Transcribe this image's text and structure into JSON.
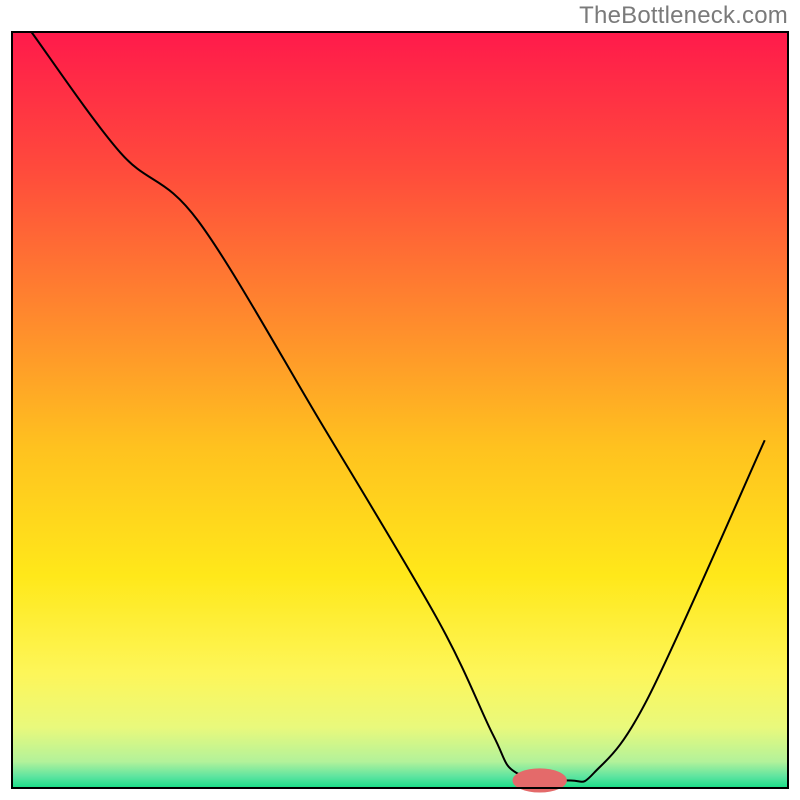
{
  "watermark": "TheBottleneck.com",
  "chart_data": {
    "type": "line",
    "title": "",
    "xlabel": "",
    "ylabel": "",
    "xlim": [
      0,
      100
    ],
    "ylim": [
      0,
      100
    ],
    "grid": false,
    "legend": false,
    "background_gradient_stops": [
      {
        "offset": 0,
        "color": "#ff1a4b"
      },
      {
        "offset": 0.18,
        "color": "#ff4a3c"
      },
      {
        "offset": 0.38,
        "color": "#ff8a2d"
      },
      {
        "offset": 0.55,
        "color": "#ffc21f"
      },
      {
        "offset": 0.72,
        "color": "#ffe81a"
      },
      {
        "offset": 0.85,
        "color": "#fdf65a"
      },
      {
        "offset": 0.92,
        "color": "#e9f97c"
      },
      {
        "offset": 0.965,
        "color": "#b3f29a"
      },
      {
        "offset": 0.985,
        "color": "#5de4a0"
      },
      {
        "offset": 1.0,
        "color": "#18dd87"
      }
    ],
    "series": [
      {
        "name": "bottleneck-curve",
        "color": "#000000",
        "x": [
          2.5,
          14,
          24,
          40,
          55,
          62,
          65,
          72,
          75,
          82,
          97
        ],
        "y": [
          100,
          84,
          75,
          48,
          22,
          7,
          2,
          1,
          2,
          12,
          46
        ]
      }
    ],
    "marker": {
      "name": "highlight-marker",
      "color": "#e46a6a",
      "x": 68,
      "y": 1,
      "rx": 3.5,
      "ry": 1.6
    },
    "frame": {
      "color": "#000000",
      "stroke_width": 2,
      "inset_top": 32,
      "inset_right": 12,
      "inset_bottom": 12,
      "inset_left": 12
    }
  }
}
